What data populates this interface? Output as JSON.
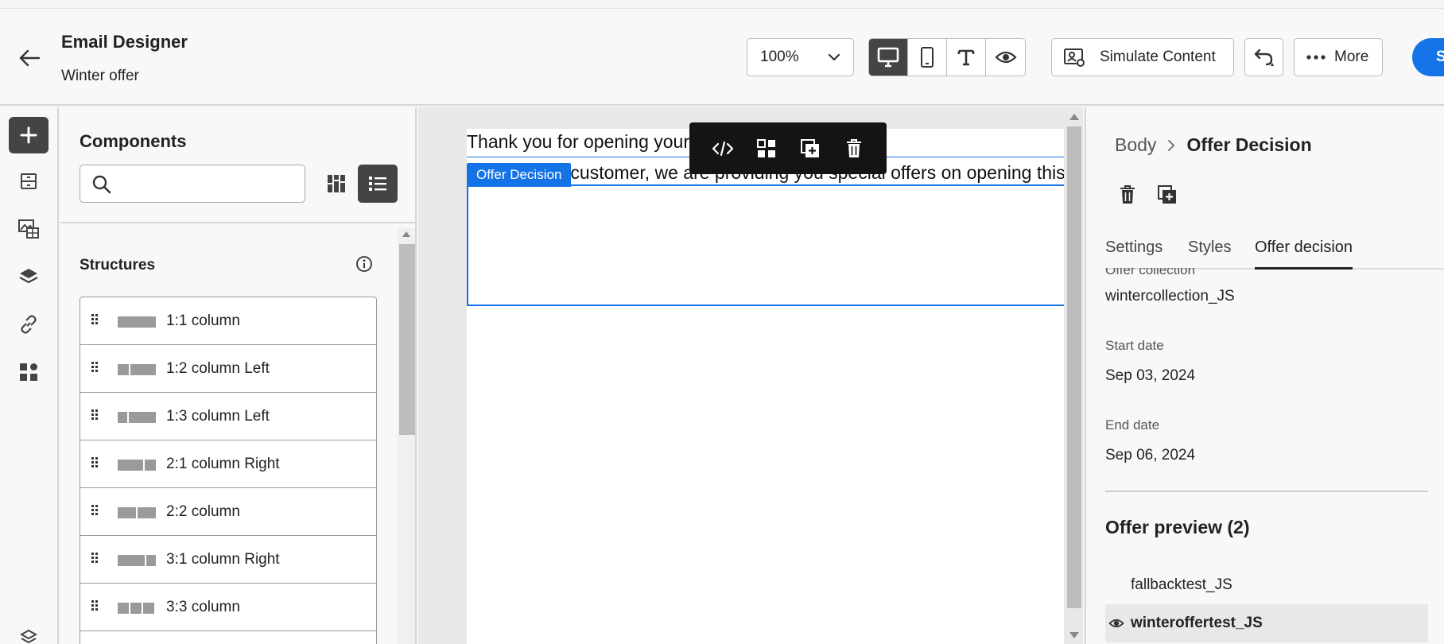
{
  "header": {
    "title": "Email Designer",
    "subtitle": "Winter offer",
    "zoom": "100%",
    "simulate_label": "Simulate Content",
    "more_label": "More",
    "primary_label": "S"
  },
  "components": {
    "title": "Components",
    "search_placeholder": "",
    "section_title": "Structures",
    "items": [
      {
        "label": "1:1 column"
      },
      {
        "label": "1:2 column Left"
      },
      {
        "label": "1:3 column Left"
      },
      {
        "label": "2:1 column Right"
      },
      {
        "label": "2:2 column"
      },
      {
        "label": "3:1 column Right"
      },
      {
        "label": "3:3 column"
      }
    ]
  },
  "canvas": {
    "text1": "Thank you for opening your email.",
    "text2": "Dear valued customer, we are providing you special offers on opening this email.",
    "offer_tag": "Offer Decision"
  },
  "properties": {
    "breadcrumb_parent": "Body",
    "breadcrumb_current": "Offer Decision",
    "tabs": [
      "Settings",
      "Styles",
      "Offer decision"
    ],
    "collection_label": "Offer collection",
    "collection_value": "wintercollection_JS",
    "start_label": "Start date",
    "start_value": "Sep 03, 2024",
    "end_label": "End date",
    "end_value": "Sep 06, 2024",
    "preview_title": "Offer preview (2)",
    "preview_items": [
      "fallbacktest_JS",
      "winteroffertest_JS"
    ]
  },
  "colors": {
    "accent": "#1473e6",
    "active_dark": "#444444",
    "toolbar": "#141414"
  }
}
